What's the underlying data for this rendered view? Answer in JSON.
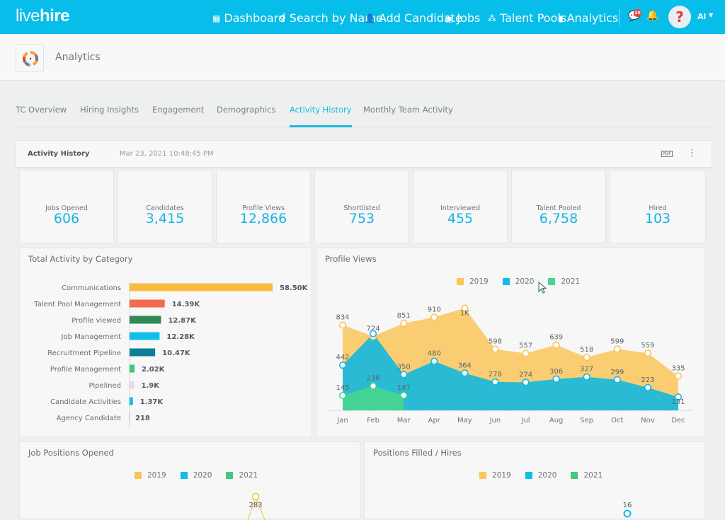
{
  "topbar": {
    "logo_light": "live",
    "logo_bold": "hire",
    "nav": [
      {
        "label": "Dashboard",
        "icon": "grid-icon"
      },
      {
        "label": "Search by Name",
        "icon": "search-user-icon"
      },
      {
        "label": "Add Candidate",
        "icon": "add-user-icon"
      },
      {
        "label": "Jobs",
        "icon": "briefcase-icon"
      },
      {
        "label": "Talent Pools",
        "icon": "group-icon"
      },
      {
        "label": "Analytics",
        "icon": "bar-chart-icon"
      }
    ],
    "messages_badge": "20",
    "avatar_glyph": "?",
    "user_name": "Al"
  },
  "header": {
    "title": "Analytics"
  },
  "tabs": [
    {
      "label": "TC Overview",
      "active": false
    },
    {
      "label": "Hiring Insights",
      "active": false
    },
    {
      "label": "Engagement",
      "active": false
    },
    {
      "label": "Demographics",
      "active": false
    },
    {
      "label": "Activity History",
      "active": true
    },
    {
      "label": "Monthly Team Activity",
      "active": false
    }
  ],
  "activity_history": {
    "title": "Activity History",
    "timestamp": "Mar 23, 2021 10:48:45 PM",
    "pdf_label": "PDF",
    "stats": [
      {
        "label": "Jobs Opened",
        "value": "606"
      },
      {
        "label": "Candidates",
        "value": "3,415"
      },
      {
        "label": "Profile Views",
        "value": "12,866"
      },
      {
        "label": "Shortlisted",
        "value": "753"
      },
      {
        "label": "Interviewed",
        "value": "455"
      },
      {
        "label": "Talent Pooled",
        "value": "6,758"
      },
      {
        "label": "Hired",
        "value": "103"
      }
    ]
  },
  "legend_labels": [
    "2019",
    "2020",
    "2021"
  ],
  "chart_data": [
    {
      "type": "bar",
      "orientation": "horizontal",
      "title": "Total Activity by Category",
      "categories": [
        "Communications",
        "Talent Pool Management",
        "Profile viewed",
        "Job Management",
        "Recruitment Pipeline",
        "Profile Management",
        "Pipelined",
        "Candidate Activities",
        "Agency Candidate"
      ],
      "values": [
        58500,
        14390,
        12870,
        12280,
        10470,
        2020,
        1900,
        1370,
        218
      ],
      "value_labels": [
        "58.50K",
        "14.39K",
        "12.87K",
        "12.28K",
        "10.47K",
        "2.02K",
        "1.9K",
        "1.37K",
        "218"
      ],
      "colors": [
        "#f9bb3d",
        "#f26b4f",
        "#2f8a55",
        "#11bfe9",
        "#0f7d96",
        "#45c77f",
        "#dde1e4",
        "#11bfe9",
        "#cccccc"
      ]
    },
    {
      "type": "area",
      "title": "Profile Views",
      "categories": [
        "Jan",
        "Feb",
        "Mar",
        "Apr",
        "May",
        "Jun",
        "Jul",
        "Aug",
        "Sep",
        "Oct",
        "Nov",
        "Dec"
      ],
      "series": [
        {
          "name": "2019",
          "color": "#fbc55a",
          "values": [
            834,
            724,
            851,
            910,
            1000,
            598,
            557,
            639,
            518,
            599,
            559,
            335
          ],
          "labels": [
            "834",
            "724",
            "851",
            "910",
            "1K",
            "598",
            "557",
            "639",
            "518",
            "599",
            "559",
            "335"
          ]
        },
        {
          "name": "2020",
          "color": "#18b9dc",
          "values": [
            442,
            750,
            350,
            480,
            364,
            278,
            274,
            306,
            327,
            299,
            223,
            131
          ],
          "labels": [
            "442",
            "",
            "350",
            "480",
            "364",
            "278",
            "274",
            "306",
            "327",
            "299",
            "223",
            "131"
          ]
        },
        {
          "name": "2021",
          "color": "#45d491",
          "values": [
            145,
            238,
            147
          ],
          "labels": [
            "145",
            "238",
            "147"
          ]
        }
      ],
      "ylim": [
        0,
        1100
      ],
      "legend": "top-center"
    },
    {
      "type": "line",
      "title": "Job Positions Opened",
      "legend_entries": [
        "2019",
        "2020",
        "2021"
      ],
      "visible_points": [
        {
          "series": "2019",
          "value": 283
        }
      ]
    },
    {
      "type": "line",
      "title": "Positions Filled / Hires",
      "legend_entries": [
        "2019",
        "2020",
        "2021"
      ],
      "visible_points": [
        {
          "series": "2020",
          "value": 16
        }
      ]
    }
  ]
}
